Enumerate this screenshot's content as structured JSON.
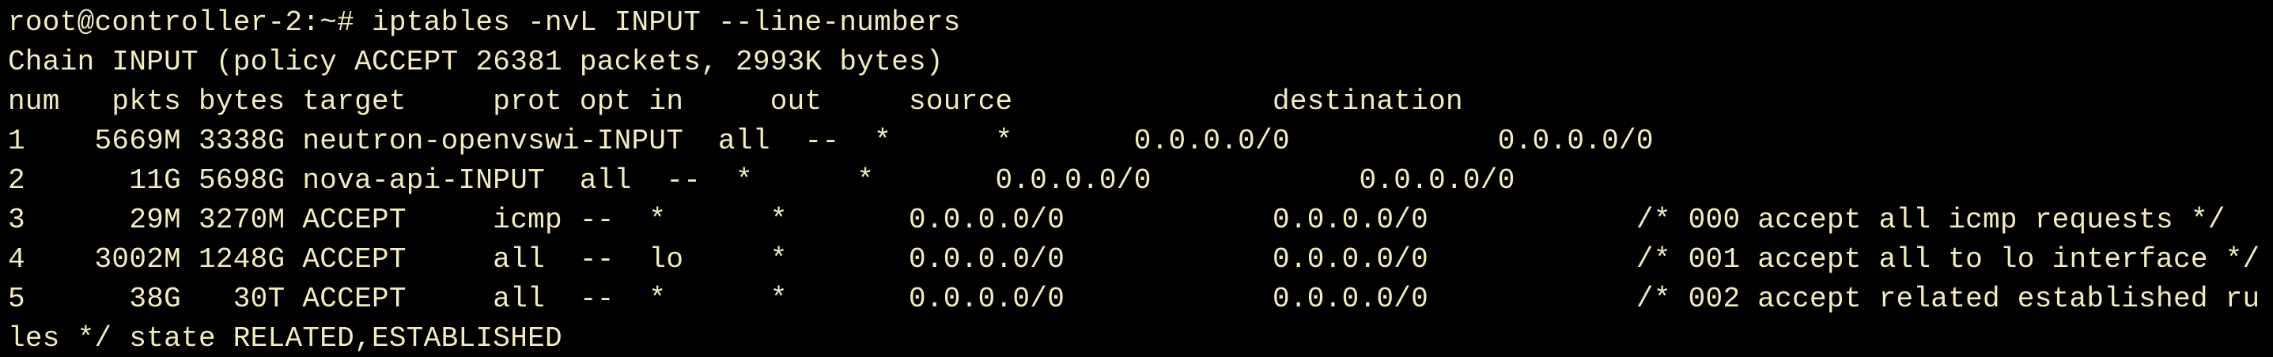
{
  "colors": {
    "background": "#000000",
    "foreground": "#f3ecc0"
  },
  "terminal": {
    "command_line": "root@controller-2:~# iptables -nvL INPUT --line-numbers",
    "chain_header": "Chain INPUT (policy ACCEPT 26381 packets, 2993K bytes)",
    "columns_header": "num   pkts bytes target     prot opt in     out     source               destination",
    "rules": [
      "1    5669M 3338G neutron-openvswi-INPUT  all  --  *      *       0.0.0.0/0            0.0.0.0/0",
      "2      11G 5698G nova-api-INPUT  all  --  *      *       0.0.0.0/0            0.0.0.0/0",
      "3      29M 3270M ACCEPT     icmp --  *      *       0.0.0.0/0            0.0.0.0/0            /* 000 accept all icmp requests */",
      "4    3002M 1248G ACCEPT     all  --  lo     *       0.0.0.0/0            0.0.0.0/0            /* 001 accept all to lo interface */",
      "5      38G   30T ACCEPT     all  --  *      *       0.0.0.0/0            0.0.0.0/0            /* 002 accept related established ru"
    ],
    "wrapped_continuation": "les */ state RELATED,ESTABLISHED"
  }
}
